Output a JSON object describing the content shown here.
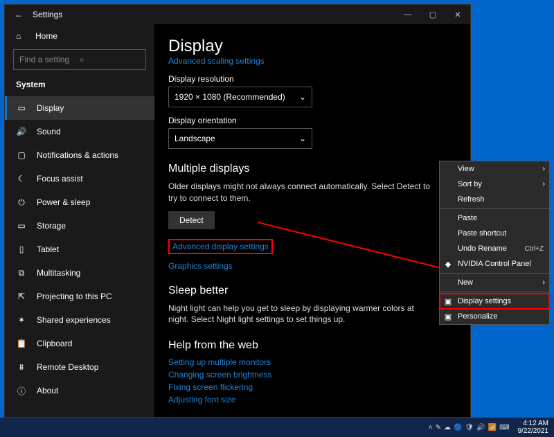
{
  "window": {
    "title": "Settings",
    "back_icon": "←",
    "min": "—",
    "max": "▢",
    "close": "✕"
  },
  "sidebar": {
    "home_icon": "⌂",
    "home": "Home",
    "search_placeholder": "Find a setting",
    "search_icon": "⌕",
    "category": "System",
    "items": [
      {
        "icon": "▭",
        "label": "Display",
        "selected": true
      },
      {
        "icon": "🔊",
        "label": "Sound"
      },
      {
        "icon": "▢",
        "label": "Notifications & actions"
      },
      {
        "icon": "☾",
        "label": "Focus assist"
      },
      {
        "icon": "⏻",
        "label": "Power & sleep"
      },
      {
        "icon": "▭",
        "label": "Storage"
      },
      {
        "icon": "▯",
        "label": "Tablet"
      },
      {
        "icon": "⧉",
        "label": "Multitasking"
      },
      {
        "icon": "⇱",
        "label": "Projecting to this PC"
      },
      {
        "icon": "✶",
        "label": "Shared experiences"
      },
      {
        "icon": "📋",
        "label": "Clipboard"
      },
      {
        "icon": "⩩",
        "label": "Remote Desktop"
      },
      {
        "icon": "ⓘ",
        "label": "About"
      }
    ]
  },
  "main": {
    "heading": "Display",
    "adv_scaling": "Advanced scaling settings",
    "res_label": "Display resolution",
    "res_value": "1920 × 1080 (Recommended)",
    "orient_label": "Display orientation",
    "orient_value": "Landscape",
    "multi_heading": "Multiple displays",
    "multi_desc": "Older displays might not always connect automatically. Select Detect to try to connect to them.",
    "detect": "Detect",
    "adv_display": "Advanced display settings",
    "graphics": "Graphics settings",
    "sleep_heading": "Sleep better",
    "sleep_desc": "Night light can help you get to sleep by displaying warmer colors at night. Select Night light settings to set things up.",
    "help_heading": "Help from the web",
    "help_links": [
      "Setting up multiple monitors",
      "Changing screen brightness",
      "Fixing screen flickering",
      "Adjusting font size"
    ],
    "chevron": "⌄"
  },
  "context_menu": {
    "items": [
      {
        "label": "View",
        "arrow": "›"
      },
      {
        "label": "Sort by",
        "arrow": "›"
      },
      {
        "label": "Refresh"
      },
      {
        "sep": true
      },
      {
        "label": "Paste"
      },
      {
        "label": "Paste shortcut"
      },
      {
        "label": "Undo Rename",
        "kb": "Ctrl+Z"
      },
      {
        "icon": "◆",
        "label": "NVIDIA Control Panel"
      },
      {
        "sep": true
      },
      {
        "label": "New",
        "arrow": "›"
      },
      {
        "sep": true
      },
      {
        "icon": "▣",
        "label": "Display settings",
        "highlight": true
      },
      {
        "icon": "▣",
        "label": "Personalize"
      }
    ]
  },
  "taskbar": {
    "tray_icons": [
      "˄",
      "✎",
      "☁",
      "🔵",
      "🛡",
      "🔊",
      "📶",
      "⌨"
    ],
    "time": "4:12 AM",
    "date": "9/22/2021"
  }
}
